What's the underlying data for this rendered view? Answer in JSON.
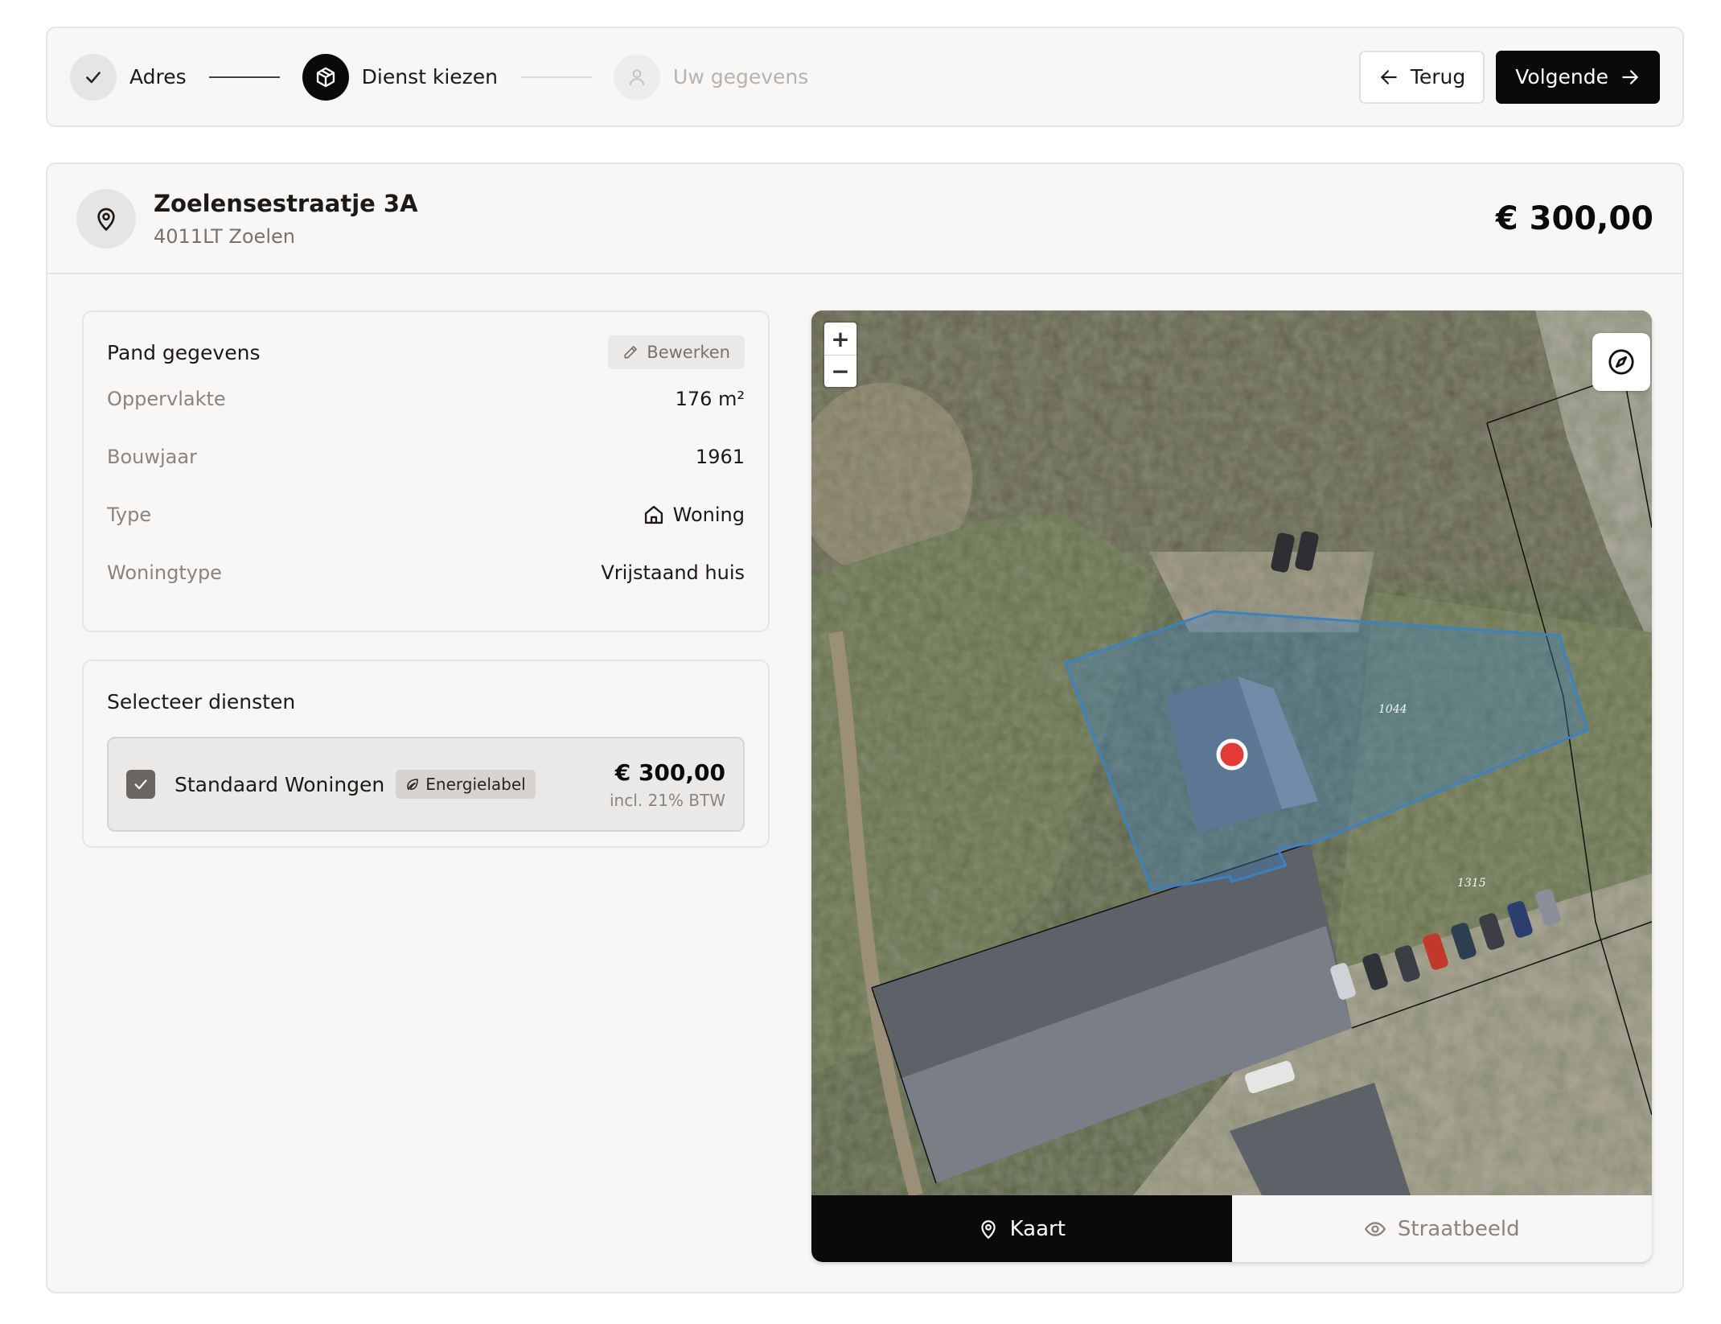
{
  "stepper": {
    "steps": [
      {
        "label": "Adres",
        "state": "done",
        "icon": "check-icon"
      },
      {
        "label": "Dienst kiezen",
        "state": "active",
        "icon": "package-icon"
      },
      {
        "label": "Uw gegevens",
        "state": "pending",
        "icon": "user-icon"
      }
    ],
    "back_label": "Terug",
    "next_label": "Volgende"
  },
  "address": {
    "street": "Zoelensestraatje 3A",
    "city": "4011LT Zoelen",
    "icon": "map-pin-icon"
  },
  "total_price": "€ 300,00",
  "pand": {
    "title": "Pand gegevens",
    "edit_label": "Bewerken",
    "rows": [
      {
        "key": "Oppervlakte",
        "value": "176 m²"
      },
      {
        "key": "Bouwjaar",
        "value": "1961"
      },
      {
        "key": "Type",
        "value": "Woning",
        "icon": "home-icon"
      },
      {
        "key": "Woningtype",
        "value": "Vrijstaand huis"
      }
    ]
  },
  "diensten": {
    "title": "Selecteer diensten",
    "items": [
      {
        "name": "Standaard Woningen",
        "tag": "Energielabel",
        "tag_icon": "leaf-icon",
        "price": "€ 300,00",
        "vat": "incl. 21% BTW",
        "checked": true
      }
    ]
  },
  "map": {
    "zoom_in": "+",
    "zoom_out": "−",
    "parcel_labels": [
      "1044",
      "1315"
    ],
    "marker_color": "#e53935",
    "outline_color": "#3b82c4",
    "tabs": [
      {
        "label": "Kaart",
        "icon": "map-pin-icon",
        "active": true
      },
      {
        "label": "Straatbeeld",
        "icon": "eye-icon",
        "active": false
      }
    ]
  }
}
